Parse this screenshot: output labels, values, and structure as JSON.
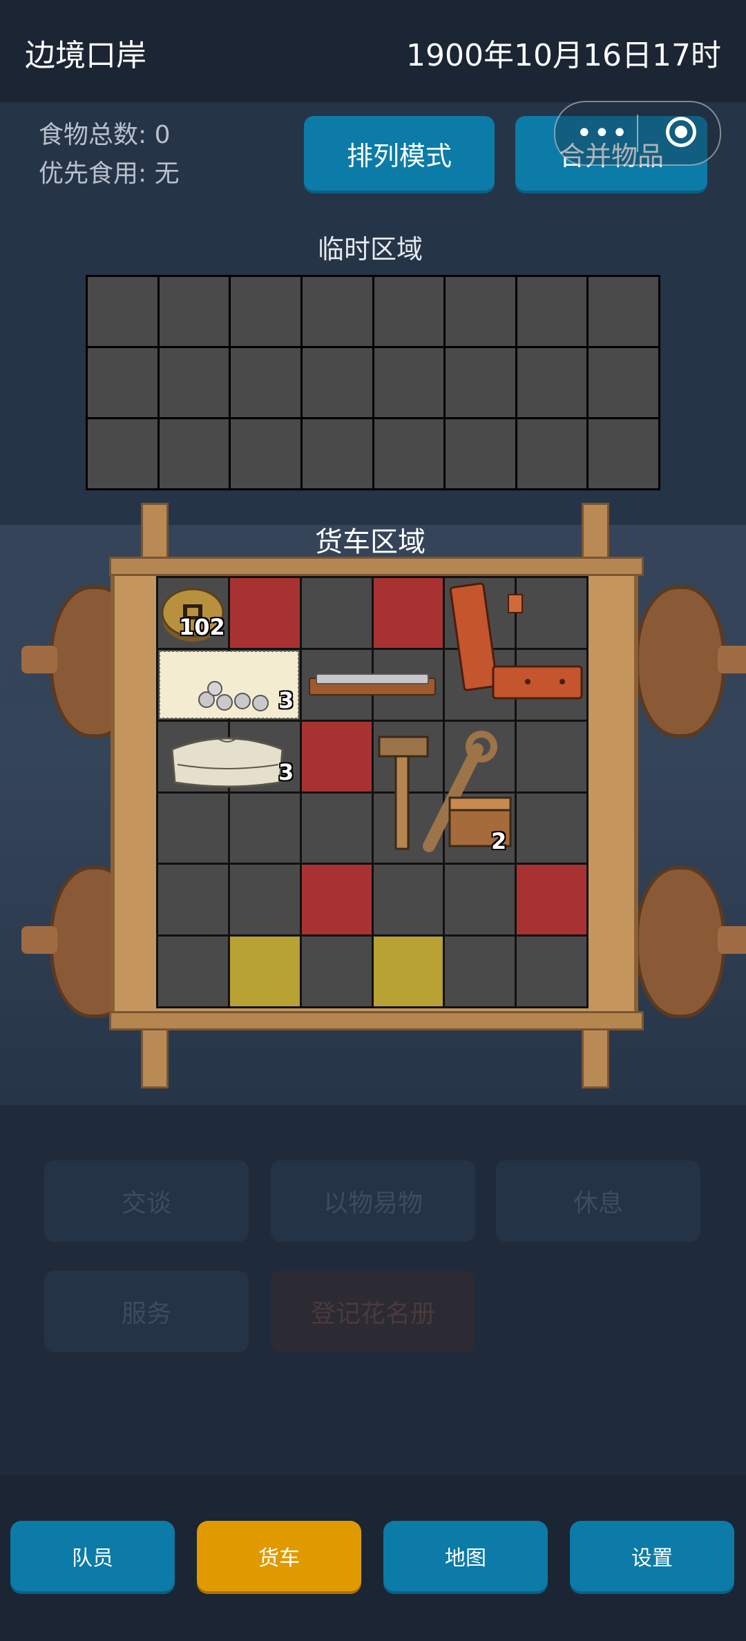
{
  "header": {
    "location": "边境口岸",
    "datetime": "1900年10月16日17时"
  },
  "food": {
    "total_label": "食物总数: 0",
    "priority_label": "优先食用: 无"
  },
  "buttons": {
    "sort_mode": "排列模式",
    "merge_items": "合并物品"
  },
  "miniprogram_capsule": {
    "more_icon": "more-dots-icon",
    "close_icon": "target-circle-icon",
    "dots": "•••"
  },
  "temp_area": {
    "title": "临时区域",
    "cols": 8,
    "rows": 3
  },
  "cart_area": {
    "title": "货车区域",
    "cols": 6,
    "rows": 6,
    "cells": [
      "empty",
      "red",
      "empty",
      "red",
      "empty",
      "empty",
      "empty",
      "empty",
      "empty",
      "empty",
      "empty",
      "empty",
      "empty",
      "empty",
      "red",
      "empty",
      "empty",
      "empty",
      "empty",
      "empty",
      "empty",
      "empty",
      "empty",
      "empty",
      "empty",
      "empty",
      "red",
      "empty",
      "empty",
      "red",
      "empty",
      "yellow",
      "empty",
      "yellow",
      "empty",
      "empty"
    ],
    "items": [
      {
        "name": "copper-coin",
        "count": "102"
      },
      {
        "name": "silver-coins-cloth",
        "count": "3"
      },
      {
        "name": "harmonica",
        "count": ""
      },
      {
        "name": "wooden-planks",
        "count": ""
      },
      {
        "name": "clothes-bundle",
        "count": "3"
      },
      {
        "name": "tools-hammer-wrench",
        "count": "2"
      }
    ]
  },
  "actions": {
    "talk": "交谈",
    "barter": "以物易物",
    "rest": "休息",
    "service": "服务",
    "register": "登记花名册"
  },
  "nav": {
    "team": "队员",
    "cart": "货车",
    "map": "地图",
    "settings": "设置"
  },
  "colors": {
    "primary": "#0c7ba8",
    "active": "#e09a00",
    "blocked": "#a83232",
    "special": "#b8a233"
  }
}
